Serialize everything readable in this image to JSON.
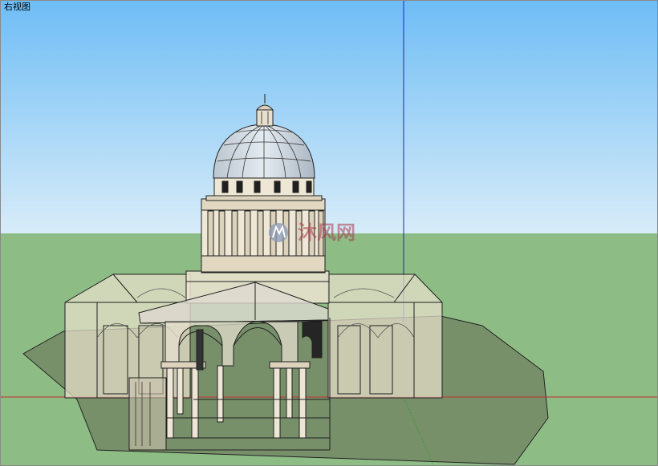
{
  "viewport": {
    "view_name": "右视图",
    "sky_top_color": "#6ebdf6",
    "sky_bottom_color": "#d8ecf8",
    "ground_color": "#8dbd85",
    "site_color": "#78906a",
    "axis_blue": "#2020c8",
    "axis_red": "#c03030",
    "axis_green": "#30a030"
  },
  "model": {
    "name": "domed-cathedral",
    "wall_fill": "#e9e0cc",
    "glass_fill": "#c7d4de",
    "edge_color": "#202020"
  },
  "watermark": {
    "icon": "mf-logo-icon",
    "text": "沐风网"
  }
}
